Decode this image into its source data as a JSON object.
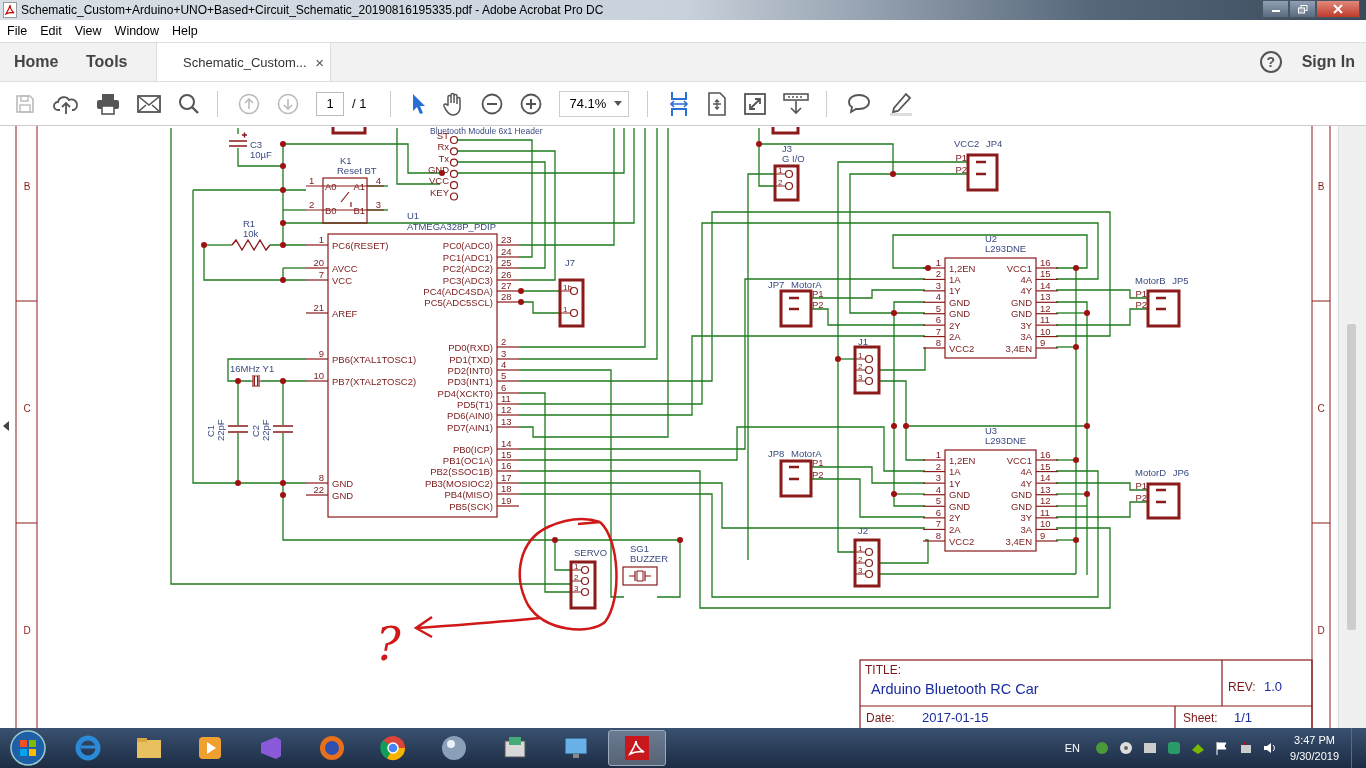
{
  "window": {
    "title": "Schematic_Custom+Arduino+UNO+Based+Circuit_Schematic_20190816195335.pdf - Adobe Acrobat Pro DC"
  },
  "menu": [
    "File",
    "Edit",
    "View",
    "Window",
    "Help"
  ],
  "tabs": [
    {
      "label": "Home",
      "selected": false
    },
    {
      "label": "Tools",
      "selected": false
    },
    {
      "label": "Schematic_Custom...",
      "selected": true,
      "close": "×"
    }
  ],
  "help": "?",
  "sign_in": "Sign In",
  "toolbar": {
    "page": "1",
    "page_count": "/ 1",
    "zoom": "74.1%"
  },
  "schematic": {
    "zones_left": [
      "B",
      "C",
      "D"
    ],
    "zones_right": [
      "B",
      "C",
      "D"
    ],
    "parts": [
      {
        "kind": "bt-header",
        "title": "Bluetooth Module 6x1 Header",
        "pins": [
          "ST",
          "Rx",
          "Tx",
          "GND",
          "VCC",
          "KEY"
        ]
      },
      {
        "kind": "capacitor",
        "ref": "C3",
        "value": "10µF"
      },
      {
        "kind": "switch",
        "ref": "K1",
        "value": "Reset BT",
        "pins": [
          {
            "num": "1",
            "name": "A0"
          },
          {
            "num": "4",
            "name": "A1"
          },
          {
            "num": "2",
            "name": "B0"
          },
          {
            "num": "3",
            "name": "B1"
          }
        ]
      },
      {
        "kind": "resistor",
        "ref": "R1",
        "value": "10k"
      },
      {
        "kind": "ic",
        "ref": "U1",
        "value": "ATMEGA328P_PDIP",
        "left_pins": [
          {
            "num": "1",
            "name": "PC6(RESET)"
          },
          {
            "num": "20",
            "name": "AVCC"
          },
          {
            "num": "7",
            "name": "VCC"
          },
          {
            "num": "21",
            "name": "AREF"
          },
          {
            "num": "9",
            "name": "PB6(XTAL1TOSC1)"
          },
          {
            "num": "10",
            "name": "PB7(XTAL2TOSC2)"
          },
          {
            "num": "8",
            "name": "GND"
          },
          {
            "num": "22",
            "name": "GND"
          }
        ],
        "right_pins": [
          {
            "num": "23",
            "name": "PC0(ADC0)"
          },
          {
            "num": "24",
            "name": "PC1(ADC1)"
          },
          {
            "num": "25",
            "name": "PC2(ADC2)"
          },
          {
            "num": "26",
            "name": "PC3(ADC3)"
          },
          {
            "num": "27",
            "name": "PC4(ADC4SDA)"
          },
          {
            "num": "28",
            "name": "PC5(ADC5SCL)"
          },
          {
            "num": "2",
            "name": "PD0(RXD)"
          },
          {
            "num": "3",
            "name": "PD1(TXD)"
          },
          {
            "num": "4",
            "name": "PD2(INT0)"
          },
          {
            "num": "5",
            "name": "PD3(INT1)"
          },
          {
            "num": "6",
            "name": "PD4(XCKT0)"
          },
          {
            "num": "11",
            "name": "PD5(T1)"
          },
          {
            "num": "12",
            "name": "PD6(AIN0)"
          },
          {
            "num": "13",
            "name": "PD7(AIN1)"
          },
          {
            "num": "14",
            "name": "PB0(ICP)"
          },
          {
            "num": "15",
            "name": "PB1(OC1A)"
          },
          {
            "num": "16",
            "name": "PB2(SSOC1B)"
          },
          {
            "num": "17",
            "name": "PB3(MOSIOC2)"
          },
          {
            "num": "18",
            "name": "PB4(MISO)"
          },
          {
            "num": "19",
            "name": "PB5(SCK)"
          }
        ]
      },
      {
        "kind": "crystal",
        "ref": "Y1",
        "value": "16MHz"
      },
      {
        "kind": "capacitor-v",
        "ref": "C1",
        "value": "22pF"
      },
      {
        "kind": "capacitor-v",
        "ref": "C2",
        "value": "22pF"
      },
      {
        "kind": "header",
        "label": "J7",
        "pins": [
          "1b",
          "1"
        ]
      },
      {
        "kind": "header",
        "label": "J3",
        "sublabel": "G I/O",
        "pins": [
          "1",
          "2"
        ]
      },
      {
        "kind": "terminal",
        "label": "VCC2 JP4",
        "pins": [
          "P1",
          "P2"
        ]
      },
      {
        "kind": "terminal",
        "label": "JP7 MotorA",
        "pins": [
          "P1",
          "P2"
        ]
      },
      {
        "kind": "ic",
        "ref": "U2",
        "value": "L293DNE",
        "left_pins": [
          {
            "num": "1",
            "name": "1,2EN"
          },
          {
            "num": "2",
            "name": "1A"
          },
          {
            "num": "3",
            "name": "1Y"
          },
          {
            "num": "4",
            "name": "GND"
          },
          {
            "num": "5",
            "name": "GND"
          },
          {
            "num": "6",
            "name": "2Y"
          },
          {
            "num": "7",
            "name": "2A"
          },
          {
            "num": "8",
            "name": "VCC2"
          }
        ],
        "right_pins": [
          {
            "num": "16",
            "name": "VCC1"
          },
          {
            "num": "15",
            "name": "4A"
          },
          {
            "num": "14",
            "name": "4Y"
          },
          {
            "num": "13",
            "name": "GND"
          },
          {
            "num": "12",
            "name": "GND"
          },
          {
            "num": "11",
            "name": "3Y"
          },
          {
            "num": "10",
            "name": "3A"
          },
          {
            "num": "9",
            "name": "3,4EN"
          }
        ]
      },
      {
        "kind": "terminal",
        "label": "MotorB JP5",
        "pins": [
          "P1",
          "P2"
        ]
      },
      {
        "kind": "header",
        "label": "J1",
        "pins": [
          "1",
          "2",
          "3"
        ]
      },
      {
        "kind": "terminal",
        "label": "JP8 MotorA",
        "pins": [
          "P1",
          "P2"
        ]
      },
      {
        "kind": "ic",
        "ref": "U3",
        "value": "L293DNE",
        "left_pins": [
          {
            "num": "1",
            "name": "1,2EN"
          },
          {
            "num": "2",
            "name": "1A"
          },
          {
            "num": "3",
            "name": "1Y"
          },
          {
            "num": "4",
            "name": "GND"
          },
          {
            "num": "5",
            "name": "GND"
          },
          {
            "num": "6",
            "name": "2Y"
          },
          {
            "num": "7",
            "name": "2A"
          },
          {
            "num": "8",
            "name": "VCC2"
          }
        ],
        "right_pins": [
          {
            "num": "16",
            "name": "VCC1"
          },
          {
            "num": "15",
            "name": "4A"
          },
          {
            "num": "14",
            "name": "4Y"
          },
          {
            "num": "13",
            "name": "GND"
          },
          {
            "num": "12",
            "name": "GND"
          },
          {
            "num": "11",
            "name": "3Y"
          },
          {
            "num": "10",
            "name": "3A"
          },
          {
            "num": "9",
            "name": "3,4EN"
          }
        ]
      },
      {
        "kind": "terminal",
        "label": "MotorD JP6",
        "pins": [
          "P1",
          "P2"
        ]
      },
      {
        "kind": "header",
        "label": "J2",
        "pins": [
          "1",
          "2",
          "3"
        ]
      },
      {
        "kind": "header",
        "label": "SERVO",
        "pins": [
          "1",
          "2",
          "3"
        ]
      },
      {
        "kind": "buzzer",
        "ref": "SG1",
        "value": "BUZZER"
      }
    ],
    "title_block": {
      "title_label": "TITLE:",
      "title": "Arduino Bluetooth RC Car",
      "rev_label": "REV:",
      "rev": "1.0",
      "date_label": "Date:",
      "date": "2017-01-15",
      "sheet_label": "Sheet:",
      "sheet": "1/1"
    },
    "annotation": {
      "mark": "?"
    }
  },
  "taskbar": {
    "language": "EN",
    "time": "3:47 PM",
    "date": "9/30/2019"
  }
}
